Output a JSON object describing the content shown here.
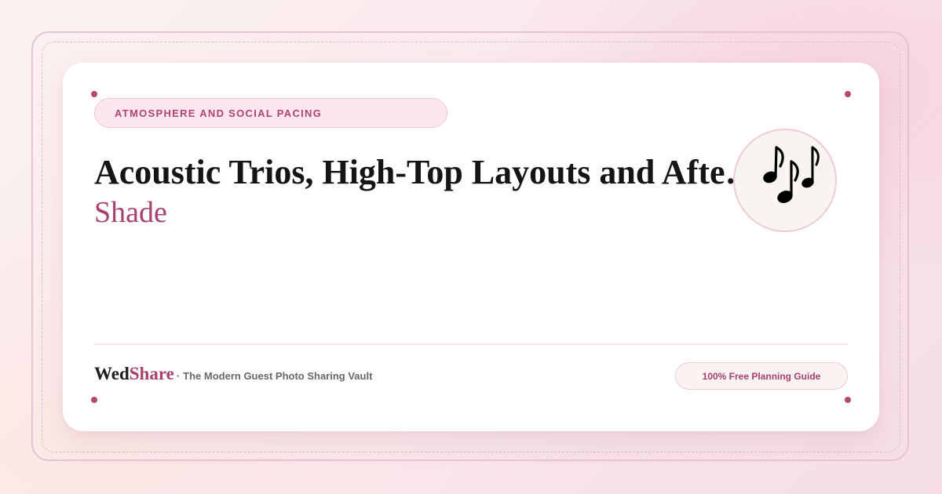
{
  "card": {
    "category": "ATMOSPHERE AND SOCIAL PACING",
    "title": "Acoustic Trios, High-Top Layouts and Afternoon",
    "subtitle": "Shade",
    "icon": "music-notes-icon"
  },
  "footer": {
    "brand_part1": "Wed",
    "brand_part2": "Share",
    "brand_separator": "·",
    "tagline": "The Modern Guest Photo Sharing Vault",
    "badge": "100% Free Planning Guide"
  },
  "colors": {
    "accent": "#a8416e",
    "accent_light": "#fde6ef",
    "title": "#151515",
    "background": "#f9e7ec",
    "card": "#ffffff"
  }
}
